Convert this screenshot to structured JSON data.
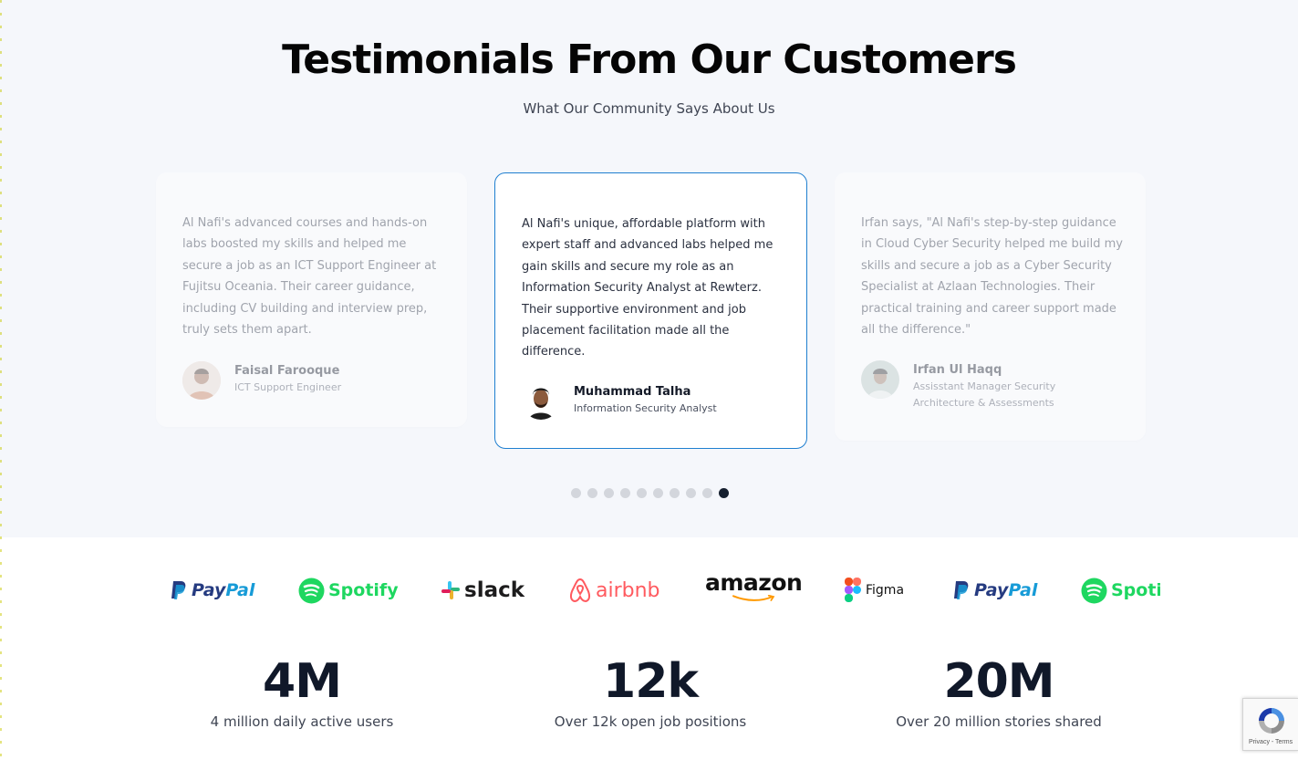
{
  "section": {
    "title": "Testimonials From Our Customers",
    "subtitle": "What Our Community Says About Us"
  },
  "testimonials": [
    {
      "quote": "Al Nafi's advanced courses and hands-on labs boosted my skills and helped me secure a job as an ICT Support Engineer at Fujitsu Oceania. Their career guidance, including CV building and interview prep, truly sets them apart.",
      "name": "Faisal Farooque",
      "role": "ICT Support Engineer"
    },
    {
      "quote": "Al Nafi's unique, affordable platform with expert staff and advanced labs helped me gain skills and secure my role as an Information Security Analyst at Rewterz. Their supportive environment and job placement facilitation made all the difference.",
      "name": "Muhammad Talha",
      "role": "Information Security Analyst"
    },
    {
      "quote": "Irfan says, \"Al Nafi's step-by-step guidance in Cloud Cyber Security helped me build my skills and secure a job as a Cyber Security Specialist at Azlaan Technologies. Their practical training and career support made all the difference.\"",
      "name": "Irfan Ul Haqq",
      "role": "Assisstant Manager Security Architecture & Assessments"
    }
  ],
  "pagination": {
    "total": 10,
    "active": 10
  },
  "logos": {
    "paypal": "PayPal",
    "spotify": "Spotify",
    "slack": "slack",
    "airbnb": "airbnb",
    "amazon": "amazon",
    "figma": "Figma",
    "paypal2": "PayPal",
    "spotify2": "Spotify"
  },
  "stats": [
    {
      "value": "4M",
      "label": "4 million daily active users"
    },
    {
      "value": "12k",
      "label": "Over 12k open job positions"
    },
    {
      "value": "20M",
      "label": "Over 20 million stories shared"
    }
  ],
  "recaptcha": {
    "label": "Privacy - Terms"
  },
  "colors": {
    "accent": "#1f7fd0",
    "paypal_dark": "#253b80",
    "paypal_light": "#179bd7",
    "spotify": "#1ed760",
    "airbnb": "#ff5a5f",
    "amazon_orange": "#ff9900"
  }
}
